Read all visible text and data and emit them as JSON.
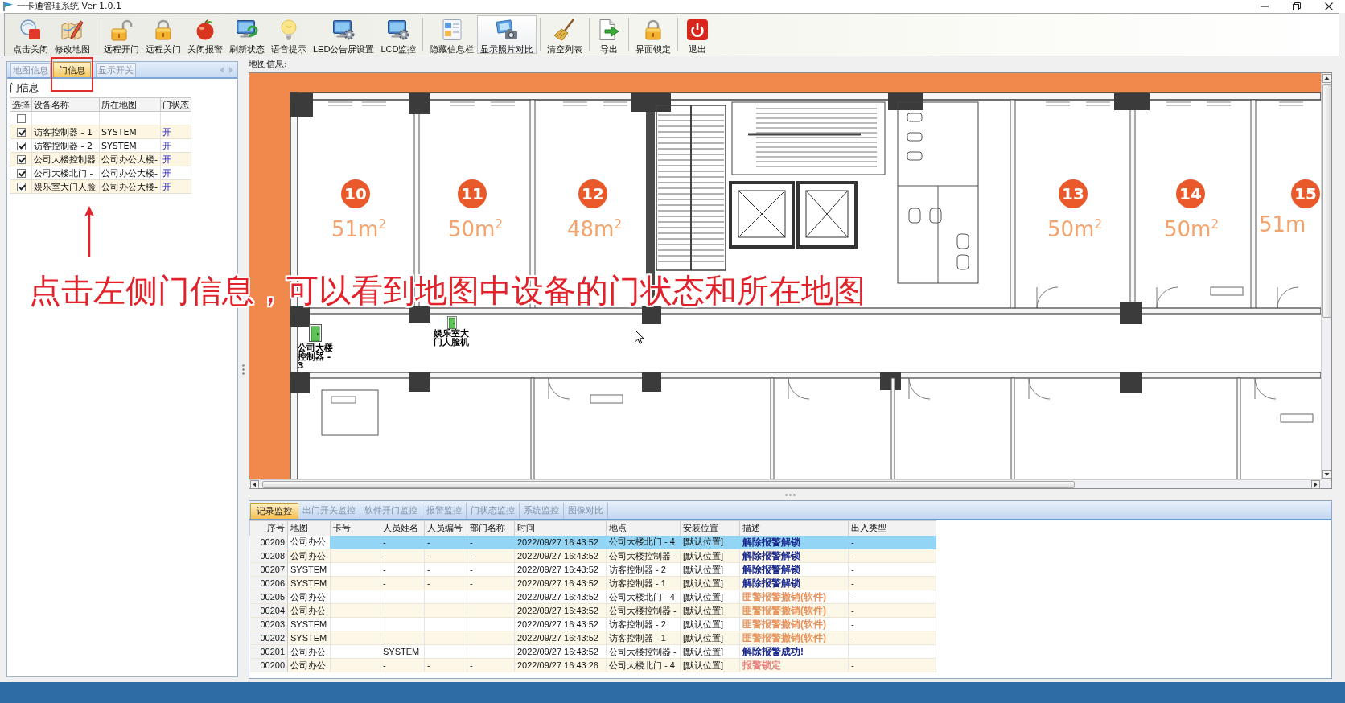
{
  "window": {
    "title": "一卡通管理系统 Ver 1.0.1"
  },
  "toolbar": {
    "groups": [
      {
        "buttons": [
          {
            "label": "点击关闭",
            "pressed": false
          },
          {
            "label": "修改地图",
            "pressed": false
          }
        ]
      },
      {
        "buttons": [
          {
            "label": "远程开门",
            "pressed": false
          },
          {
            "label": "远程关门",
            "pressed": false
          },
          {
            "label": "关闭报警",
            "pressed": false
          },
          {
            "label": "刷新状态",
            "pressed": false
          },
          {
            "label": "语音提示",
            "pressed": false
          },
          {
            "label": "LED公告屏设置",
            "pressed": false
          },
          {
            "label": "LCD监控",
            "pressed": false
          }
        ]
      },
      {
        "buttons": [
          {
            "label": "隐藏信息栏",
            "pressed": false
          },
          {
            "label": "显示照片对比",
            "pressed": true
          }
        ]
      },
      {
        "buttons": [
          {
            "label": "清空列表",
            "pressed": false
          }
        ]
      },
      {
        "buttons": [
          {
            "label": "导出",
            "pressed": false
          }
        ]
      },
      {
        "buttons": [
          {
            "label": "界面锁定",
            "pressed": false
          }
        ]
      },
      {
        "buttons": [
          {
            "label": "退出",
            "pressed": false
          }
        ]
      }
    ]
  },
  "door_panel": {
    "tabs": [
      {
        "label": "地图信息",
        "selected": false
      },
      {
        "label": "门信息",
        "selected": true
      },
      {
        "label": "显示开关",
        "selected": false
      }
    ],
    "section_title": "门信息",
    "grid": {
      "columns": [
        "选择",
        "设备名称",
        "所在地图",
        "门状态"
      ],
      "filter_row": {
        "checked": false
      },
      "rows": [
        {
          "checked": true,
          "device": "访客控制器 - 1",
          "map": "SYSTEM",
          "door_state": "开"
        },
        {
          "checked": true,
          "device": "访客控制器 - 2",
          "map": "SYSTEM",
          "door_state": "开"
        },
        {
          "checked": true,
          "device": "公司大楼控制器",
          "map": "公司办公大楼-",
          "door_state": "开"
        },
        {
          "checked": true,
          "device": "公司大楼北门 -",
          "map": "公司办公大楼-",
          "door_state": "开"
        },
        {
          "checked": true,
          "device": "娱乐室大门人脸",
          "map": "公司办公大楼-",
          "door_state": "开"
        }
      ]
    }
  },
  "map": {
    "title": "地图信息:",
    "rooms": [
      {
        "number": "10",
        "area": "51m$^{2}$"
      },
      {
        "number": "11",
        "area": "50m$^{2}$"
      },
      {
        "number": "12",
        "area": "48m$^{2}$"
      },
      {
        "number": "13",
        "area": "50m$^{2}$"
      },
      {
        "number": "14",
        "area": "50m$^{2}$"
      },
      {
        "number": "15",
        "area": "51m"
      }
    ],
    "devices": [
      {
        "label": "公司大楼控制器 - 3"
      },
      {
        "label": "娱乐室大门人脸机"
      }
    ]
  },
  "monitor": {
    "tabs": [
      {
        "label": "记录监控",
        "selected": true
      },
      {
        "label": "出门开关监控",
        "selected": false
      },
      {
        "label": "软件开门监控",
        "selected": false
      },
      {
        "label": "报警监控",
        "selected": false
      },
      {
        "label": "门状态监控",
        "selected": false
      },
      {
        "label": "系统监控",
        "selected": false
      },
      {
        "label": "图像对比",
        "selected": false
      }
    ],
    "table": {
      "columns": [
        "序号",
        "地图",
        "卡号",
        "人员姓名",
        "人员编号",
        "部门名称",
        "时间",
        "地点",
        "安装位置",
        "描述",
        "出入类型"
      ],
      "rows": [
        {
          "no": "00209",
          "map": "公司办公",
          "person_name": "-",
          "person_id": "-",
          "department": "-",
          "time": "2022/09/27 16:43:52",
          "location": "公司大楼北门 - 4",
          "install_position": "[默认位置]",
          "description": "解除报警解锁",
          "access_type": "-",
          "selected": true,
          "color": "#1b2a8f"
        },
        {
          "no": "00208",
          "map": "公司办公",
          "person_name": "-",
          "person_id": "-",
          "department": "-",
          "time": "2022/09/27 16:43:52",
          "location": "公司大楼控制器 -",
          "install_position": "[默认位置]",
          "description": "解除报警解锁",
          "access_type": "-",
          "selected": false,
          "color": "#1b2a8f"
        },
        {
          "no": "00207",
          "map": "SYSTEM",
          "person_name": "-",
          "person_id": "-",
          "department": "-",
          "time": "2022/09/27 16:43:52",
          "location": "访客控制器 - 2",
          "install_position": "[默认位置]",
          "description": "解除报警解锁",
          "access_type": "-",
          "selected": false,
          "color": "#1b2a8f"
        },
        {
          "no": "00206",
          "map": "SYSTEM",
          "person_name": "-",
          "person_id": "-",
          "department": "-",
          "time": "2022/09/27 16:43:52",
          "location": "访客控制器 - 1",
          "install_position": "[默认位置]",
          "description": "解除报警解锁",
          "access_type": "-",
          "selected": false,
          "color": "#1b2a8f"
        },
        {
          "no": "00205",
          "map": "公司办公",
          "time": "2022/09/27 16:43:52",
          "location": "公司大楼北门 - 4",
          "install_position": "[默认位置]",
          "description": "匪警报警撤销(软件)",
          "access_type": "-",
          "selected": false,
          "color": "#e8935c"
        },
        {
          "no": "00204",
          "map": "公司办公",
          "time": "2022/09/27 16:43:52",
          "location": "公司大楼控制器 -",
          "install_position": "[默认位置]",
          "description": "匪警报警撤销(软件)",
          "access_type": "-",
          "selected": false,
          "color": "#e8935c"
        },
        {
          "no": "00203",
          "map": "SYSTEM",
          "time": "2022/09/27 16:43:52",
          "location": "访客控制器 - 2",
          "install_position": "[默认位置]",
          "description": "匪警报警撤销(软件)",
          "access_type": "-",
          "selected": false,
          "color": "#e8935c"
        },
        {
          "no": "00202",
          "map": "SYSTEM",
          "time": "2022/09/27 16:43:52",
          "location": "访客控制器 - 1",
          "install_position": "[默认位置]",
          "description": "匪警报警撤销(软件)",
          "access_type": "-",
          "selected": false,
          "color": "#e8935c"
        },
        {
          "no": "00201",
          "map": "公司办公",
          "person_name": "SYSTEM",
          "time": "2022/09/27 16:43:52",
          "location": "公司大楼控制器 -",
          "install_position": "[默认位置]",
          "description": "解除报警成功!",
          "selected": false,
          "color": "#1b2a8f"
        },
        {
          "no": "00200",
          "map": "公司办公",
          "person_name": "-",
          "person_id": "-",
          "department": "-",
          "time": "2022/09/27 16:43:26",
          "location": "公司大楼北门 - 4",
          "install_position": "[默认位置]",
          "description": "报警锁定",
          "access_type": "-",
          "selected": false,
          "color": "#e8827e"
        }
      ]
    }
  },
  "annotation": {
    "caption": "点击左侧门信息，可以看到地图中设备的门状态和所在地图"
  }
}
